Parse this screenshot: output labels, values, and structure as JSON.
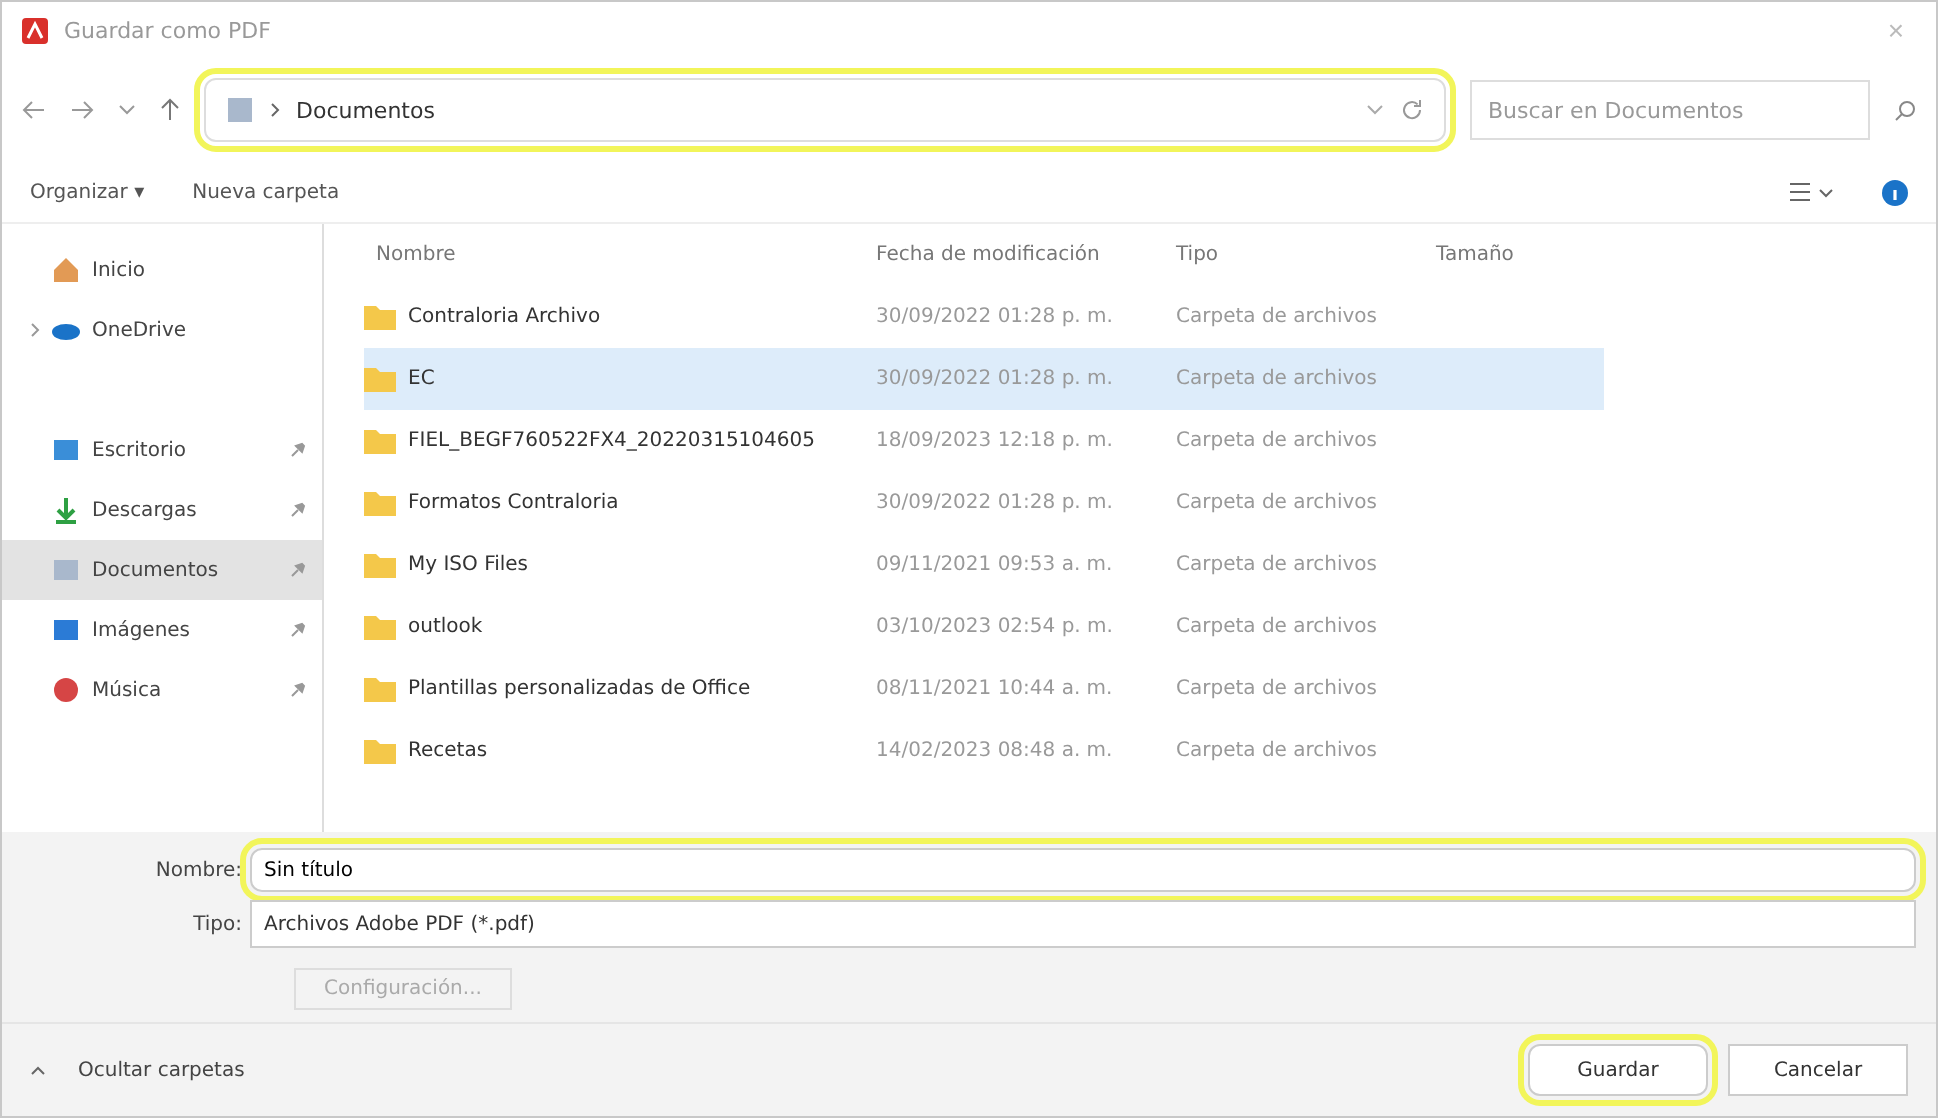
{
  "window": {
    "title": "Guardar como PDF",
    "close": "×"
  },
  "address": {
    "location": "Documentos",
    "highlighted": true
  },
  "search": {
    "placeholder": "Buscar en Documentos"
  },
  "toolbar": {
    "organize": "Organizar ▾",
    "new_folder": "Nueva carpeta"
  },
  "sidebar": {
    "items": [
      {
        "label": "Inicio",
        "kind": "home",
        "pinned": false,
        "expandable": false,
        "selected": false
      },
      {
        "label": "OneDrive",
        "kind": "cloud",
        "pinned": false,
        "expandable": true,
        "selected": false
      },
      {
        "label": "Escritorio",
        "kind": "desktop",
        "pinned": true,
        "expandable": false,
        "selected": false
      },
      {
        "label": "Descargas",
        "kind": "download",
        "pinned": true,
        "expandable": false,
        "selected": false
      },
      {
        "label": "Documentos",
        "kind": "document",
        "pinned": true,
        "expandable": false,
        "selected": true
      },
      {
        "label": "Imágenes",
        "kind": "image",
        "pinned": true,
        "expandable": false,
        "selected": false
      },
      {
        "label": "Música",
        "kind": "music",
        "pinned": true,
        "expandable": false,
        "selected": false
      }
    ]
  },
  "table": {
    "columns": [
      "Nombre",
      "Fecha de modificación",
      "Tipo",
      "Tamaño"
    ],
    "rows": [
      {
        "name": "Contraloria Archivo",
        "date": "30/09/2022 01:28 p. m.",
        "type": "Carpeta de archivos",
        "selected": false
      },
      {
        "name": "EC",
        "date": "30/09/2022 01:28 p. m.",
        "type": "Carpeta de archivos",
        "selected": true
      },
      {
        "name": "FIEL_BEGF760522FX4_20220315104605",
        "date": "18/09/2023 12:18 p. m.",
        "type": "Carpeta de archivos",
        "selected": false
      },
      {
        "name": "Formatos Contraloria",
        "date": "30/09/2022 01:28 p. m.",
        "type": "Carpeta de archivos",
        "selected": false
      },
      {
        "name": "My ISO Files",
        "date": "09/11/2021 09:53 a. m.",
        "type": "Carpeta de archivos",
        "selected": false
      },
      {
        "name": "outlook",
        "date": "03/10/2023 02:54 p. m.",
        "type": "Carpeta de archivos",
        "selected": false
      },
      {
        "name": "Plantillas personalizadas de Office",
        "date": "08/11/2021 10:44 a. m.",
        "type": "Carpeta de archivos",
        "selected": false
      },
      {
        "name": "Recetas",
        "date": "14/02/2023 08:48 a. m.",
        "type": "Carpeta de archivos",
        "selected": false
      }
    ]
  },
  "filename": {
    "label": "Nombre:",
    "value": "Sin título",
    "highlighted": true
  },
  "filetype": {
    "label": "Tipo:",
    "value": "Archivos Adobe PDF (*.pdf)"
  },
  "settings_button": {
    "label": "Configuración...",
    "disabled": true
  },
  "footer": {
    "hide_folders": "Ocultar carpetas",
    "save": {
      "label": "Guardar",
      "highlighted": true
    },
    "cancel": "Cancelar"
  }
}
